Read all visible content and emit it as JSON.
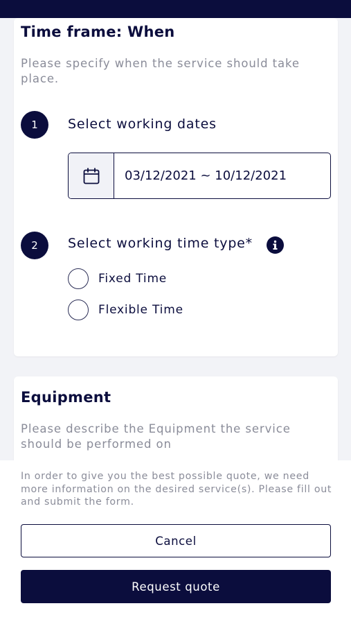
{
  "timeframe": {
    "title": "Time frame: When",
    "description": "Please specify when the service should take place.",
    "step1": {
      "number": "1",
      "label": "Select working dates",
      "date_range": "03/12/2021 ~ 10/12/2021"
    },
    "step2": {
      "number": "2",
      "label": "Select working time type*",
      "options": [
        "Fixed Time",
        "Flexible Time"
      ]
    }
  },
  "equipment": {
    "title": "Equipment",
    "description": "Please describe the Equipment the service should be performed on"
  },
  "footer": {
    "info": "In order to give you the best possible quote, we need more information on the desired service(s). Please fill out and submit the form.",
    "cancel_label": "Cancel",
    "request_label": "Request quote"
  },
  "icons": {
    "date": "calendar-icon",
    "info": "info-icon"
  },
  "colors": {
    "primary": "#0b0d3d",
    "muted_text": "#8a8c99",
    "background": "#f2f3f7"
  }
}
